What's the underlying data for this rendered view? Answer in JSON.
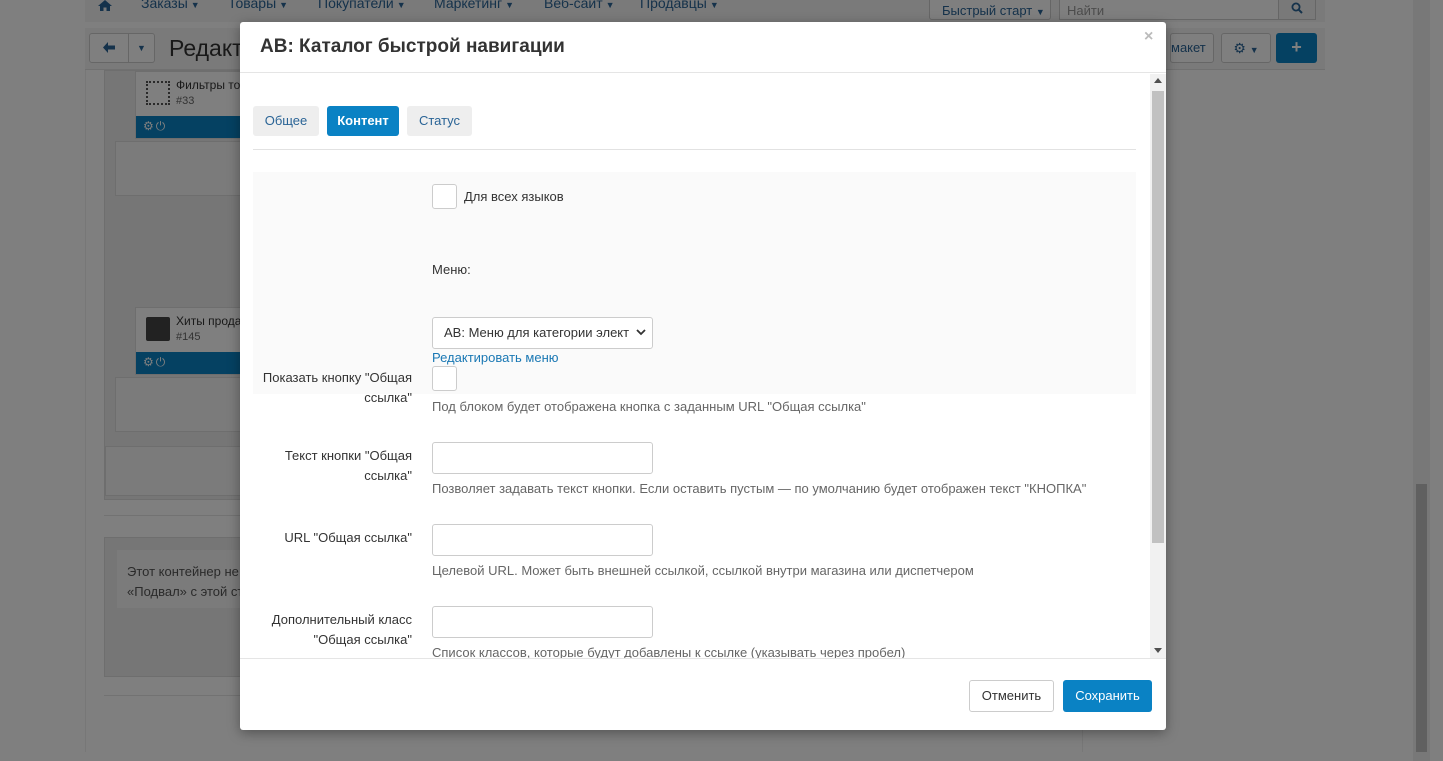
{
  "background": {
    "nav": {
      "items": [
        "Заказы",
        "Товары",
        "Покупатели",
        "Маркетинг",
        "Веб-сайт",
        "Продавцы"
      ],
      "quick_start": "Быстрый старт",
      "search_placeholder": "Найти"
    },
    "toolbar": {
      "title": "Редакт",
      "layout_button": "макет"
    },
    "blocks": [
      {
        "title": "Фильтры това",
        "id": "#33"
      },
      {
        "title": "Хиты продаж",
        "id": "#145"
      }
    ],
    "note": {
      "line1": "Этот контейнер не",
      "line2": "«Подвал» с этой стр"
    }
  },
  "modal": {
    "title": "АВ: Каталог быстрой навигации",
    "close": "×",
    "tabs": [
      {
        "label": "Общее",
        "active": false
      },
      {
        "label": "Контент",
        "active": true
      },
      {
        "label": "Статус",
        "active": false
      }
    ],
    "form": {
      "all_languages": {
        "label": "Для всех языков",
        "checked": false
      },
      "menu": {
        "label": "Меню:",
        "selected": "АВ: Меню для категории элект",
        "edit_link": "Редактировать меню"
      },
      "show_button": {
        "label_line1": "Показать кнопку \"Общая",
        "label_line2": "ссылка\"",
        "checked": false,
        "help": "Под блоком будет отображена кнопка с заданным URL \"Общая ссылка\""
      },
      "button_text": {
        "label_line1": "Текст кнопки \"Общая",
        "label_line2": "ссылка\"",
        "value": "",
        "help": "Позволяет задавать текст кнопки. Если оставить пустым — по умолчанию будет отображен текст \"КНОПКА\""
      },
      "url": {
        "label": "URL \"Общая ссылка\"",
        "value": "",
        "help": "Целевой URL. Может быть внешней ссылкой, ссылкой внутри магазина или диспетчером"
      },
      "extra_class": {
        "label_line1": "Дополнительный класс",
        "label_line2": "\"Общая ссылка\"",
        "value": "",
        "help": "Список классов, которые будут добавлены к ссылке (указывать через пробел)"
      }
    },
    "footer": {
      "cancel": "Отменить",
      "save": "Сохранить"
    }
  },
  "colors": {
    "primary": "#0a82c4",
    "link": "#1a78b4",
    "overlay": "rgba(0,0,0,0.5)"
  },
  "icons": {
    "home": "home-icon",
    "search": "search-icon",
    "back": "arrow-left-icon",
    "gear": "gear-icon",
    "plus": "plus-icon",
    "close": "close-icon",
    "select_chevron": "chevron-down-icon"
  }
}
